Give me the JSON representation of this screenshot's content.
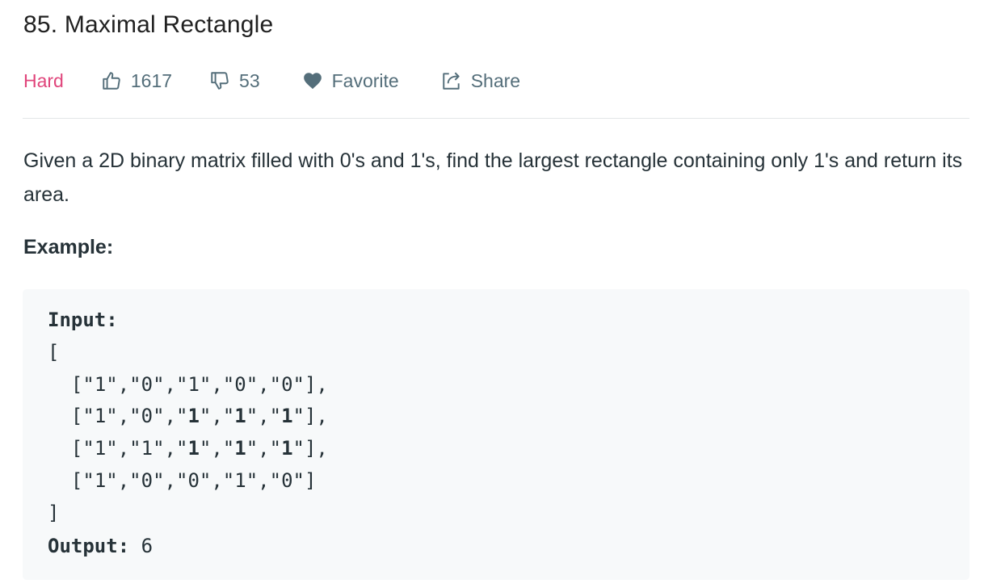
{
  "problem": {
    "title": "85. Maximal Rectangle",
    "difficulty": "Hard",
    "likes": "1617",
    "dislikes": "53",
    "favorite_label": "Favorite",
    "share_label": "Share",
    "description": "Given a 2D binary matrix filled with 0's and 1's, find the largest rectangle containing only 1's and return its area.",
    "example_label": "Example:",
    "difficulty_color": "#e0457b"
  },
  "example": {
    "input_label": "Input:",
    "open_bracket": "[",
    "close_bracket": "]",
    "rows": [
      [
        "1",
        "0",
        "1",
        "0",
        "0"
      ],
      [
        "1",
        "0",
        "1",
        "1",
        "1"
      ],
      [
        "1",
        "1",
        "1",
        "1",
        "1"
      ],
      [
        "1",
        "0",
        "0",
        "1",
        "0"
      ]
    ],
    "output_label": "Output:",
    "output_value": "6"
  },
  "icons": {
    "like": "thumbs-up-icon",
    "dislike": "thumbs-down-icon",
    "favorite": "heart-icon",
    "share": "share-icon"
  }
}
